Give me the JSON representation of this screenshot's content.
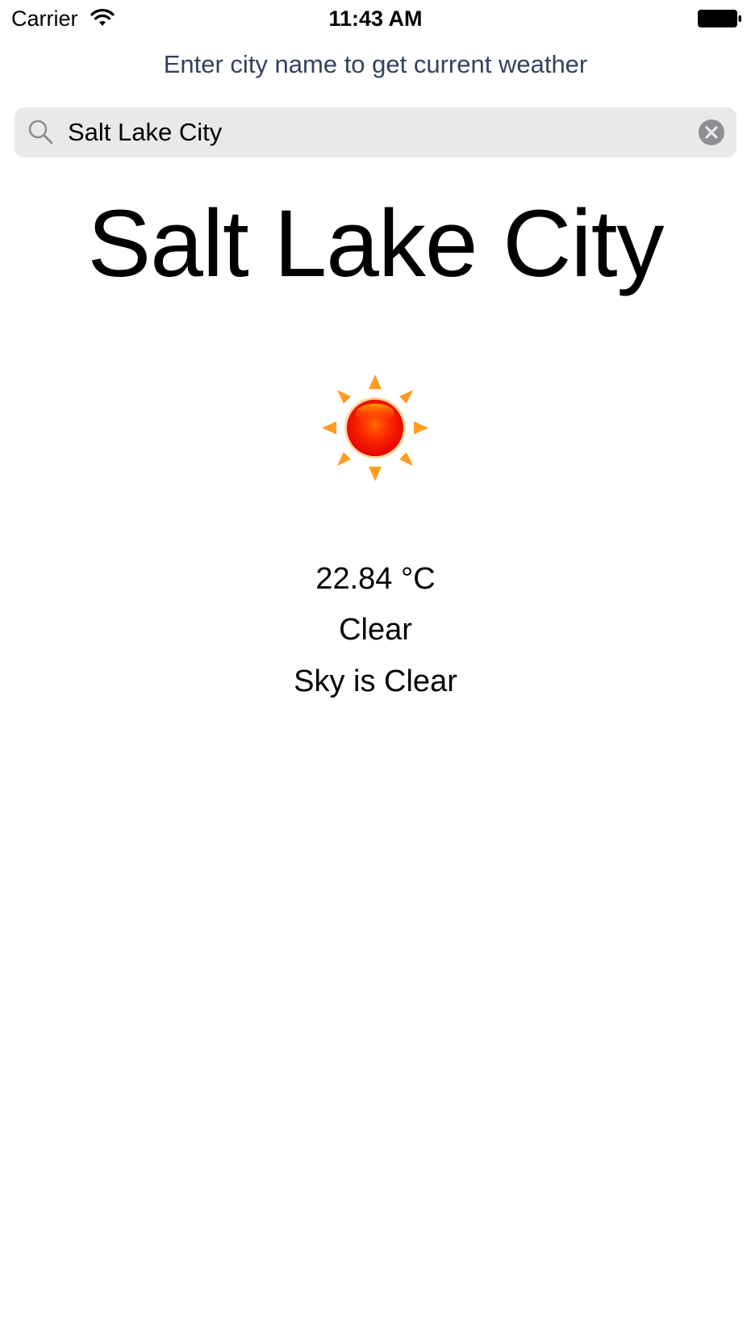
{
  "status_bar": {
    "carrier": "Carrier",
    "time": "11:43 AM",
    "wifi_icon": "wifi-icon",
    "battery_icon": "battery-icon"
  },
  "prompt": "Enter city name to get current weather",
  "search": {
    "value": "Salt Lake City",
    "icon": "search-icon",
    "clear_icon": "clear-icon"
  },
  "weather": {
    "city": "Salt Lake City",
    "icon": "sun-icon",
    "temperature": "22.84 °C",
    "condition": "Clear",
    "description": "Sky is Clear"
  },
  "colors": {
    "prompt_text": "#34425f",
    "search_background": "#e9e9eb",
    "sun_core": "#ff1a00",
    "sun_rays": "#ff9d1f"
  }
}
